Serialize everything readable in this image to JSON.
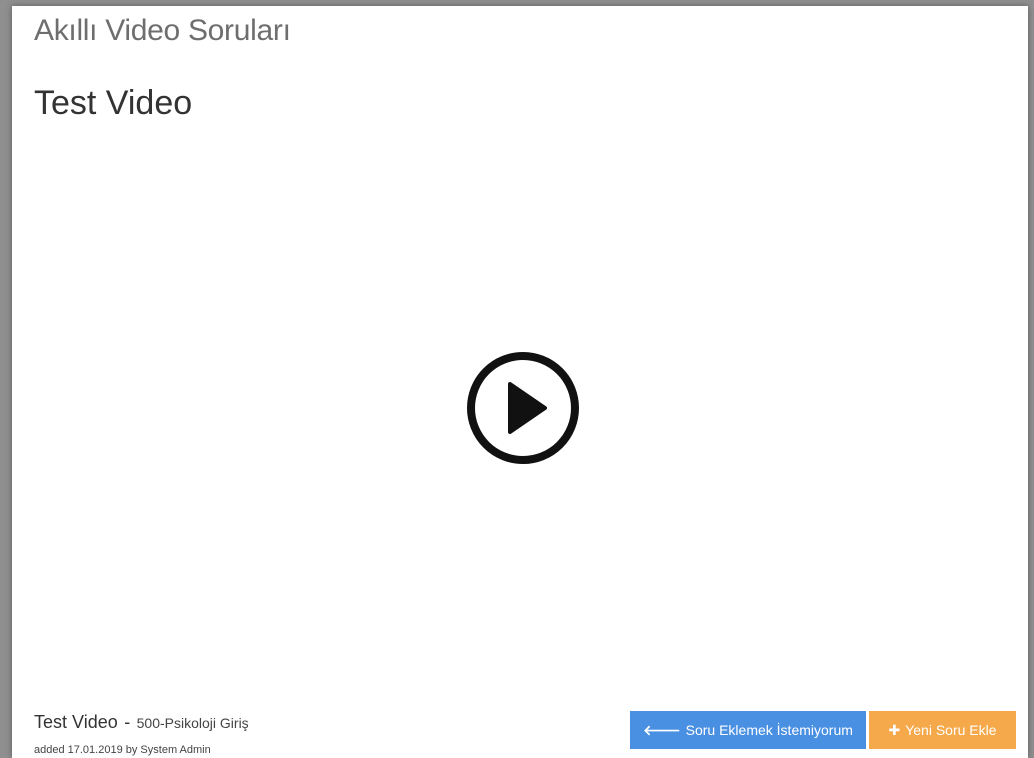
{
  "app": {
    "title": "Akıllı Video Soruları"
  },
  "video": {
    "title": "Test Video"
  },
  "player": {
    "play_icon": "play-circle-icon"
  },
  "meta": {
    "title": "Test Video",
    "separator": "-",
    "course": "500-Psikoloji Giriş",
    "added": "added 17.01.2019 by System Admin"
  },
  "actions": {
    "skip": {
      "icon": "arrow-left-icon",
      "icon_glyph": "🡐",
      "label": "Soru Eklemek İstemiyorum",
      "color": "#4a90e2"
    },
    "add": {
      "icon": "plus-icon",
      "icon_glyph": "✚",
      "label": "Yeni Soru Ekle",
      "color": "#f5a94a"
    }
  }
}
